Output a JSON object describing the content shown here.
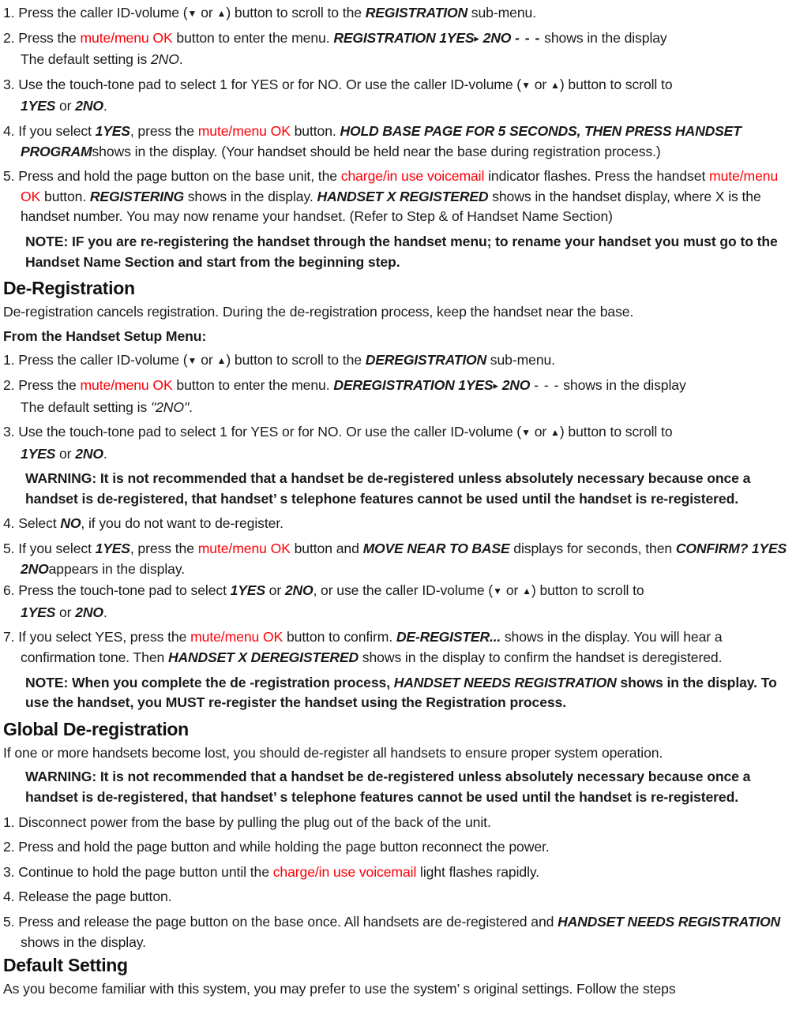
{
  "document": {
    "accent_red": "#fb0007",
    "text_color": "#1a1a1a",
    "glyphs": {
      "down_triangle": "▼",
      "up_triangle": "▲",
      "right_triangle": "▸"
    },
    "labels": {
      "mute_menu_ok": "mute/menu OK",
      "charge_in_use_voicemail": "charge/in use voicemail"
    }
  },
  "registration_steps": {
    "step1": {
      "num": "1.",
      "t1": "Press the caller ID-volume (",
      "t2": "  or ",
      "t3": ") button to scroll to the ",
      "display": "REGISTRATION",
      "t4": " sub-menu."
    },
    "step2": {
      "num": "2.",
      "t1": "Press the ",
      "red": "mute/menu OK",
      "t2": " button to enter the menu. ",
      "display": "REGISTRATION 1YES",
      "display2": "2NO",
      "dots": "- - -",
      "t3": " shows in the display",
      "cont_t1": "The default setting is ",
      "cont_italic": "2NO",
      "cont_t2": "."
    },
    "step3": {
      "num": "3.",
      "t1": "Use the touch-tone pad to select 1 for YES or for NO. Or use the caller ID-volume (",
      "t2": "  or ",
      "t3": ") button to scroll to",
      "cont_a": "1YES",
      "cont_mid": " or ",
      "cont_b": "2NO",
      "cont_end": "."
    },
    "step4": {
      "num": "4.",
      "t1": "If you select ",
      "sel": "1YES",
      "t2": ", press the ",
      "red": "mute/menu OK",
      "t3": " button. ",
      "display": "HOLD BASE PAGE FOR 5 SECONDS, THEN PRESS HANDSET PROGRAM",
      "t4": "shows in the display. (Your handset should be held near the base during registration process.)"
    },
    "step5": {
      "num": "5.",
      "t1": "Press and hold the page button on the base unit, the ",
      "red1": "charge/in use voicemail",
      "t2": " indicator flashes. Press the handset ",
      "red2": "mute/menu OK",
      "t3": " button. ",
      "display1": "REGISTERING",
      "t4": " shows in the display. ",
      "display2": "HANDSET X REGISTERED",
      "t5": " shows in the handset display, where X is the handset number. You may now rename your handset. (Refer to Step & of Handset Name Section)"
    },
    "note": "NOTE: IF you are re-registering the handset through the handset menu; to rename your handset you must go to the Handset Name Section and start from the beginning step."
  },
  "deregistration": {
    "heading": "De-Registration",
    "intro": "De-registration cancels registration. During the de-registration process, keep the handset near the base.",
    "subheading": "From the Handset Setup Menu:",
    "step1": {
      "num": "1.",
      "t1": "Press the caller ID-volume (",
      "t2": "  or ",
      "t3": ") button to scroll to the ",
      "display": "DEREGISTRATION",
      "t4": " sub-menu."
    },
    "step2": {
      "num": "2.",
      "t1": "Press the ",
      "red": "mute/menu OK",
      "t2": " button to enter the menu. ",
      "display": "DEREGISTRATION 1YES",
      "display2": "2NO",
      "dots": "- - -",
      "t3": " shows in the display",
      "cont_t1": "The default setting is ",
      "cont_italic": "\"2NO\"",
      "cont_t2": "."
    },
    "step3": {
      "num": "3.",
      "t1": "Use the touch-tone pad to select 1 for YES or for NO. Or use the caller ID-volume (",
      "t2": "  or ",
      "t3": ") button to scroll to",
      "cont_a": "1YES",
      "cont_mid": " or ",
      "cont_b": "2NO",
      "cont_end": "."
    },
    "warning": "WARNING: It is not recommended that a handset be de-registered unless absolutely necessary because once a handset is de-registered, that handset’ s telephone features cannot be used until the handset is re-registered.",
    "step4": {
      "num": "4.",
      "t1": "Select ",
      "sel": "NO",
      "t2": ", if you do not want to de-register."
    },
    "step5": {
      "num": "5.",
      "t1": "If you select ",
      "sel": "1YES",
      "t2": ", press the ",
      "red": "mute/menu OK",
      "t3": " button and ",
      "display1": "MOVE NEAR TO BASE",
      "t4": " displays for seconds, then ",
      "display2": "CONFIRM? 1YES 2NO",
      "t5": "appears in the display."
    },
    "step6": {
      "num": "6.",
      "t1": "Press the touch-tone pad to select ",
      "sel1": "1YES",
      "t2": " or ",
      "sel2": "2NO",
      "t3": ", or use the caller ID-volume (",
      "t4": "  or ",
      "t5": ") button to scroll to",
      "cont_a": "1YES",
      "cont_mid": " or ",
      "cont_b": "2NO",
      "cont_end": "."
    },
    "step7": {
      "num": "7.",
      "t1": "If you select YES, press the ",
      "red": "mute/menu OK",
      "t2": " button to confirm. ",
      "display1": "DE-REGISTER...",
      "t3": " shows in the display. You will hear a confirmation tone. Then ",
      "display2": "HANDSET X DEREGISTERED",
      "t4": " shows in the display to confirm the handset is deregistered."
    },
    "note": {
      "t1": "NOTE: When you complete the de -registration process, ",
      "display": "HANDSET NEEDS REGISTRATION",
      "t2": " shows in the display. To use the handset, you MUST re-register the handset using the Registration process."
    }
  },
  "global_deregistration": {
    "heading": "Global De-registration",
    "intro": "If one or more handsets become lost, you should de-register all handsets to ensure proper system operation.",
    "warning": "WARNING: It is not recommended that a handset be de-registered unless absolutely necessary because once a handset is de-registered, that handset’ s telephone features cannot be used until the handset is re-registered.",
    "step1": {
      "num": "1.",
      "text": "Disconnect power from the base by pulling the plug out of the back of the unit."
    },
    "step2": {
      "num": "2.",
      "text": "Press and hold the page button and while holding the page button reconnect the power."
    },
    "step3": {
      "num": "3.",
      "t1": "Continue to hold the page button until the ",
      "red": "charge/in use voicemail",
      "t2": " light flashes rapidly."
    },
    "step4": {
      "num": "4.",
      "text": "Release the page button."
    },
    "step5": {
      "num": "5.",
      "t1": "Press and release the page button on the base once. All handsets are de-registered and ",
      "display": "HANDSET NEEDS REGISTRATION",
      "t2": " shows in the display."
    }
  },
  "default_setting": {
    "heading": "Default Setting",
    "intro": "As you become familiar with this system, you may prefer to use the system’ s original settings. Follow the steps"
  }
}
